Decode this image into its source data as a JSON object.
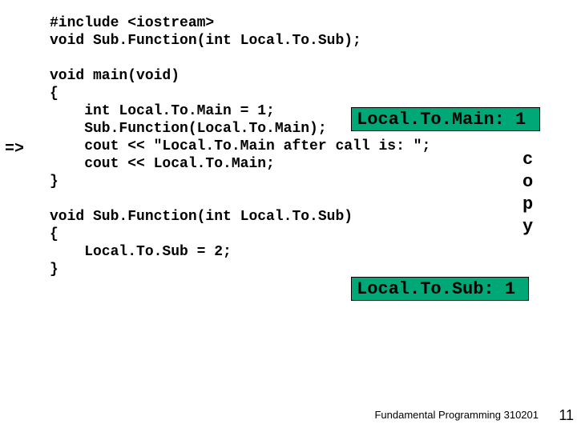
{
  "code": {
    "l1": "#include <iostream>",
    "l2": "void Sub.Function(int Local.To.Sub);",
    "l3": "",
    "l4": "void main(void)",
    "l5": "{",
    "l6": "    int Local.To.Main = 1;",
    "l7": "    Sub.Function(Local.To.Main);",
    "l8": "    cout << \"Local.To.Main after call is: \";",
    "l9": "    cout << Local.To.Main;",
    "l10": "}",
    "l11": "",
    "l12": "void Sub.Function(int Local.To.Sub)",
    "l13": "{",
    "l14": "    Local.To.Sub = 2;",
    "l15": "}"
  },
  "arrow": "=>",
  "boxes": {
    "main_var": "Local.To.Main: 1",
    "sub_var": "Local.To.Sub: 1"
  },
  "copy_letters": {
    "c": "c",
    "o": "o",
    "p": "p",
    "y": "y"
  },
  "footer": "Fundamental Programming 310201",
  "pagenum": "11",
  "chart_data": {
    "type": "table",
    "title": "Slide illustrating pass-by-value in C++",
    "variables": [
      {
        "name": "Local.To.Main",
        "value": 1
      },
      {
        "name": "Local.To.Sub",
        "value": 1
      }
    ],
    "annotation": "copy",
    "execution_pointer_line": "cout << \"Local.To.Main after call is: \";"
  }
}
